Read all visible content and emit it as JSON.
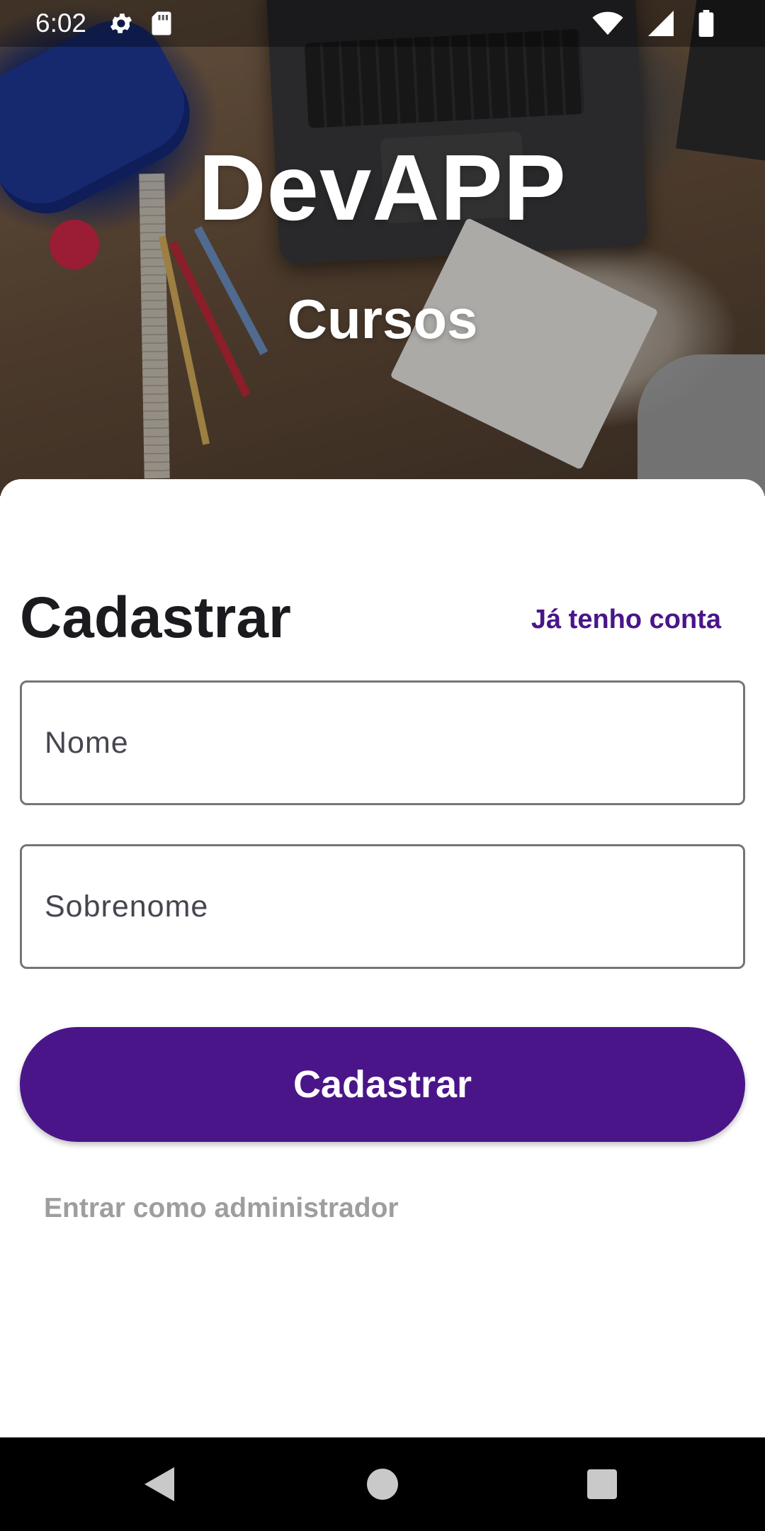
{
  "status_bar": {
    "time": "6:02",
    "icons": [
      "settings-icon",
      "sd-card-icon",
      "wifi-icon",
      "signal-icon",
      "battery-icon"
    ]
  },
  "hero": {
    "title": "DevAPP",
    "subtitle": "Cursos"
  },
  "form": {
    "heading": "Cadastrar",
    "login_link": "Já tenho conta",
    "name_placeholder": "Nome",
    "surname_placeholder": "Sobrenome",
    "submit_label": "Cadastrar",
    "admin_link": "Entrar como administrador"
  },
  "nav_bar": {
    "icons": [
      "back-icon",
      "home-icon",
      "recents-icon"
    ]
  },
  "colors": {
    "accent": "#4a1589",
    "muted_link": "#9e9e9e",
    "field_border": "#757575"
  }
}
